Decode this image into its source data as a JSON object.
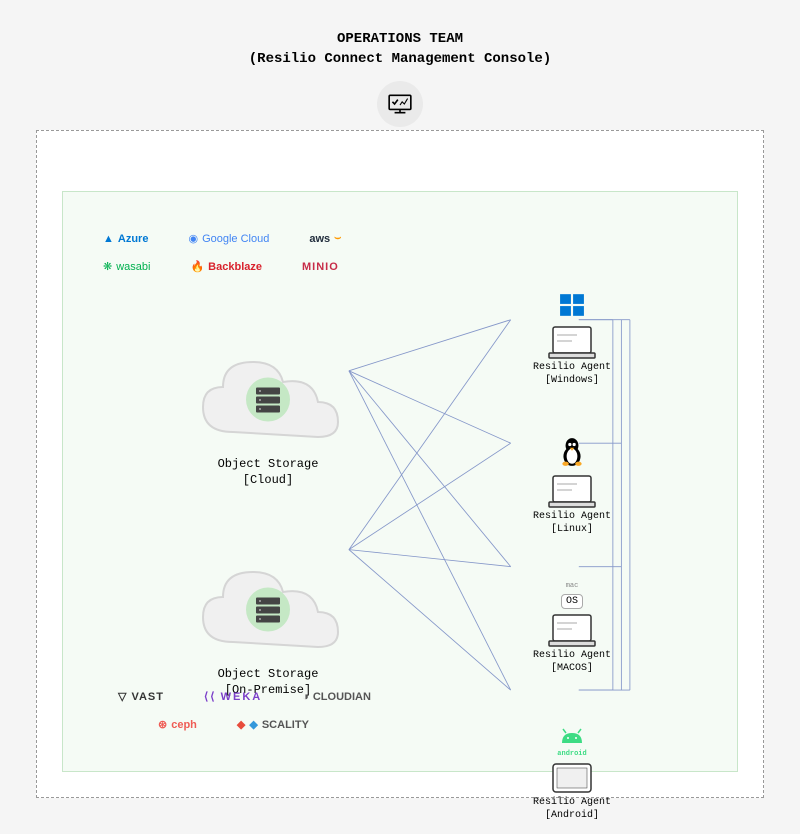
{
  "header": {
    "title": "OPERATIONS TEAM",
    "subtitle": "(Resilio Connect Management Console)"
  },
  "providers_top": {
    "azure": "Azure",
    "google": "Google Cloud",
    "aws": "aws",
    "wasabi": "wasabi",
    "backblaze": "Backblaze",
    "minio": "MINIO"
  },
  "providers_bottom": {
    "vast": "VAST",
    "weka": "WEKA",
    "cloudian": "CLOUDIAN",
    "ceph": "ceph",
    "scality": "SCALITY"
  },
  "storage": {
    "cloud": {
      "line1": "Object Storage",
      "line2": "[Cloud]"
    },
    "onprem": {
      "line1": "Object Storage",
      "line2": "[On-Premise]"
    }
  },
  "agents": {
    "windows": {
      "line1": "Resilio Agent",
      "line2": "[Windows]"
    },
    "linux": {
      "line1": "Resilio Agent",
      "line2": "[Linux]"
    },
    "macos": {
      "line1": "Resilio Agent",
      "line2": "[MACOS]",
      "badge": "OS"
    },
    "android": {
      "line1": "Resilio Agent",
      "line2": "[Android]",
      "badge": "android"
    }
  }
}
